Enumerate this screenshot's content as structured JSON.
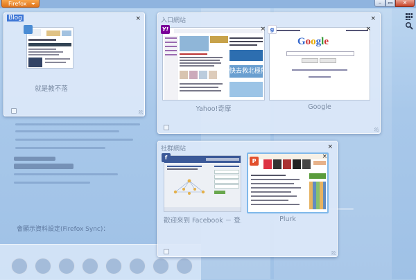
{
  "browser": {
    "menu_button_label": "Firefox",
    "window_controls": {
      "minimize": "–",
      "maximize": "▭",
      "close": "✕"
    },
    "tools": [
      {
        "name": "tab-groups-icon"
      },
      {
        "name": "search-icon"
      }
    ]
  },
  "groups": [
    {
      "id": "blog",
      "title": "Blog",
      "selected": true,
      "close": "×",
      "tabs": [
        {
          "label": "就是教不落",
          "favicon": "blog-favicon"
        }
      ]
    },
    {
      "id": "portal",
      "title": "入口網站",
      "selected": false,
      "close": "×",
      "tabs": [
        {
          "label": "Yahoo!奇摩",
          "favicon": "yahoo-favicon",
          "close": "×",
          "thumb_text": "快去救北極熊"
        },
        {
          "label": "Google",
          "favicon": "google-favicon",
          "close": "×",
          "thumb_text": "Google"
        }
      ]
    },
    {
      "id": "social",
      "title": "社群網站",
      "selected": false,
      "close": "×",
      "tabs": [
        {
          "label": "歡迎來到 Facebook － 登入・…",
          "favicon": "facebook-favicon",
          "close": "×",
          "thumb_text": "f"
        },
        {
          "label": "Plurk",
          "favicon": "plurk-favicon",
          "close": "×",
          "thumb_text": "P"
        }
      ]
    }
  ],
  "background_page": {
    "text_line": "會顯示資料設定(Firefox Sync)："
  },
  "colors": {
    "firefox_button": "#e0741a",
    "selection": "#3d76d6",
    "group_bg": "#dce8f8",
    "yahoo": "#7b0099",
    "facebook": "#3b5998",
    "plurk": "#e2502d"
  }
}
